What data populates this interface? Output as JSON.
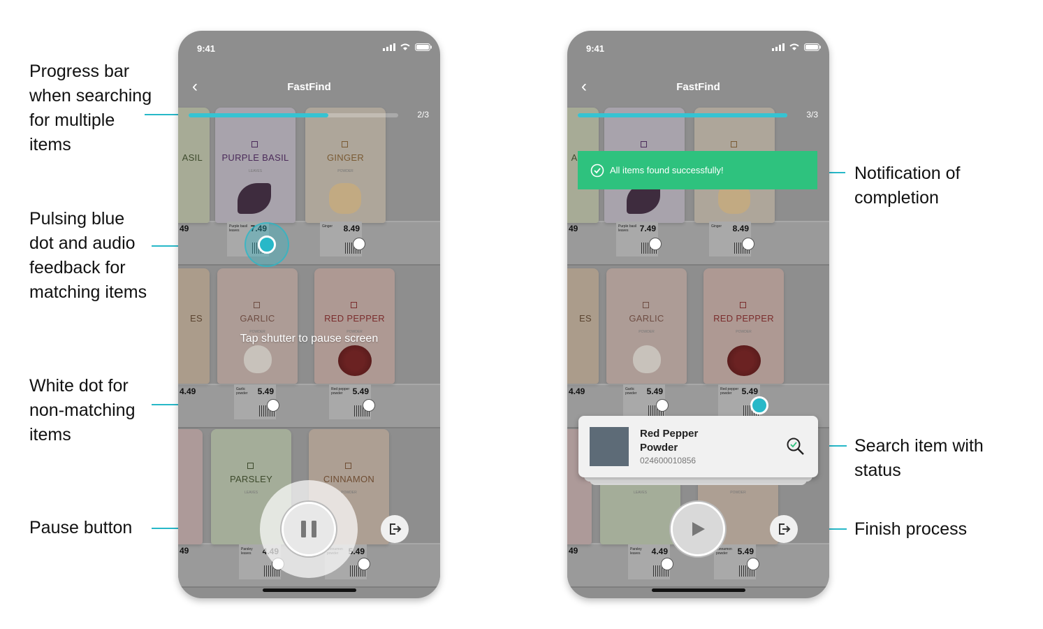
{
  "callouts": {
    "progress": "Progress bar when searching for multiple items",
    "pulse": "Pulsing blue dot and audio feedback for matching items",
    "white_dot": "White dot for non-matching items",
    "pause": "Pause button",
    "notification": "Notification of completion",
    "search_item": "Search item with status",
    "finish": "Finish process"
  },
  "app": {
    "time": "9:41",
    "title": "FastFind"
  },
  "products": {
    "basil_partial": "ASIL",
    "purple_basil": "PURPLE BASIL",
    "purple_basil_sub": "LEAVES",
    "ginger": "GINGER",
    "ginger_sub": "POWDER",
    "spices_partial": "ES",
    "garlic": "GARLIC",
    "garlic_sub": "POWDER",
    "red_pepper": "RED PEPPER",
    "red_pepper_sub": "POWDER",
    "parsley": "PARSLEY",
    "parsley_sub": "LEAVES",
    "cinnamon": "CINNAMON",
    "cinnamon_sub": "POWDER"
  },
  "tags": {
    "row1": {
      "edge": "49",
      "purple_basil_name": "Purple basil leaves",
      "purple_basil_price": "7.49",
      "ginger_name": "Ginger",
      "ginger_price": "8.49"
    },
    "row2": {
      "edge": "4.49",
      "garlic_name": "Garlic powder",
      "garlic_price": "5.49",
      "red_pepper_name": "Red pepper powder",
      "red_pepper_price": "5.49"
    },
    "row3": {
      "edge": "49",
      "parsley_name": "Parsley leaves",
      "parsley_price": "4.49",
      "cinnamon_name": "Cinnamon powder",
      "cinnamon_price": "5.49"
    }
  },
  "screen1": {
    "progress_text": "2/3",
    "progress_fraction": 0.667,
    "hint": "Tap shutter to pause screen"
  },
  "screen2": {
    "progress_text": "3/3",
    "progress_fraction": 1.0,
    "toast": "All items found successfully!",
    "card": {
      "name": "Red Pepper Powder",
      "code": "024600010856"
    }
  },
  "colors": {
    "accent": "#27b8c8",
    "success": "#2ec27e",
    "thumb": "#5d6b77"
  }
}
